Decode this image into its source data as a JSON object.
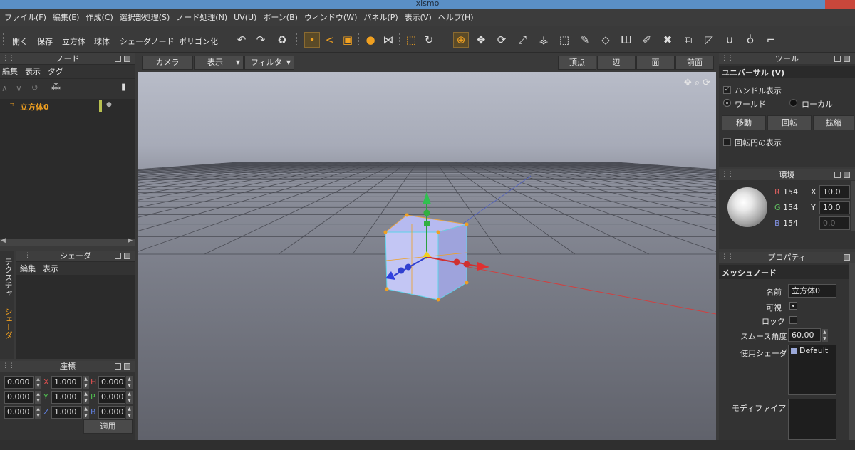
{
  "window": {
    "title": "xismo"
  },
  "menu": [
    "ファイル(F)",
    "編集(E)",
    "作成(C)",
    "選択部処理(S)",
    "ノード処理(N)",
    "UV(U)",
    "ボーン(B)",
    "ウィンドウ(W)",
    "パネル(P)",
    "表示(V)",
    "ヘルプ(H)"
  ],
  "toolbar": {
    "open": "開く",
    "save": "保存",
    "cube": "立方体",
    "sphere": "球体",
    "shader_node": "シェーダノード",
    "polygonize": "ポリゴン化"
  },
  "node_panel": {
    "title": "ノード",
    "menu": [
      "編集",
      "表示",
      "タグ"
    ],
    "items": [
      {
        "label": "立方体0"
      }
    ]
  },
  "shader_panel": {
    "title": "シェーダ",
    "menu": [
      "編集",
      "表示"
    ],
    "tabs": [
      "テクスチャ",
      "シェーダ"
    ]
  },
  "coord_panel": {
    "title": "座標",
    "rows": [
      {
        "v1": "0.000",
        "l2": "X",
        "v2": "1.000",
        "l3": "H",
        "v3": "0.000"
      },
      {
        "v1": "0.000",
        "l2": "Y",
        "v2": "1.000",
        "l3": "P",
        "v3": "0.000"
      },
      {
        "v1": "0.000",
        "l2": "Z",
        "v2": "1.000",
        "l3": "B",
        "v3": "0.000"
      }
    ],
    "apply": "適用"
  },
  "viewport": {
    "camera": "カメラ",
    "display": "表示",
    "filter": "フィルタ",
    "modes": [
      "頂点",
      "辺",
      "面",
      "前面"
    ]
  },
  "tool_panel": {
    "title": "ツール",
    "mode": "ユニバーサル (V)",
    "show_handle": "ハンドル表示",
    "world": "ワールド",
    "local": "ローカル",
    "move": "移動",
    "rotate": "回転",
    "scale": "拡縮",
    "show_rotation_circle": "回転円の表示"
  },
  "env_panel": {
    "title": "環境",
    "r_label": "R",
    "r": "154",
    "g_label": "G",
    "g": "154",
    "b_label": "B",
    "b": "154",
    "x_label": "X",
    "x": "10.0",
    "y_label": "Y",
    "y": "10.0",
    "z": "0.0"
  },
  "prop_panel": {
    "title": "プロパティ",
    "section": "メッシュノード",
    "name_label": "名前",
    "name": "立方体0",
    "visible_label": "可視",
    "lock_label": "ロック",
    "smooth_label": "スムース角度",
    "smooth": "60.00",
    "shader_label": "使用シェーダ",
    "shader": "Default",
    "modifier_label": "モディファイア"
  },
  "colors": {
    "accent": "#f0a020",
    "title_bar": "#5a8fc6",
    "grid": "#4a4c54"
  }
}
